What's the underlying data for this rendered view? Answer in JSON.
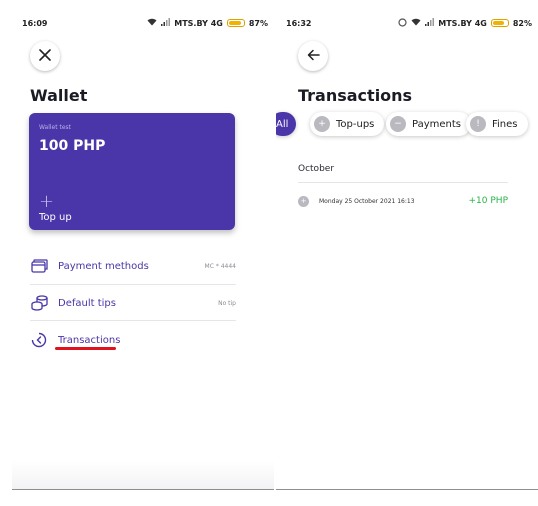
{
  "colors": {
    "primary": "#4a36a9",
    "underline": "#e0121e",
    "positive": "#28b34a"
  },
  "left": {
    "status": {
      "time": "16:09",
      "carrier": "MTS.BY 4G",
      "battery": "87%",
      "battery_level": 0.87
    },
    "close_icon": "close-icon",
    "title": "Wallet",
    "card": {
      "subtitle": "Wallet test",
      "amount": "100 PHP",
      "plus": "+",
      "topup": "Top up"
    },
    "menu": [
      {
        "label": "Payment methods",
        "value": "MC * 4444",
        "icon": "card-icon"
      },
      {
        "label": "Default tips",
        "value": "No tip",
        "icon": "coins-icon"
      },
      {
        "label": "Transactions",
        "value": "",
        "icon": "history-icon"
      }
    ]
  },
  "right": {
    "status": {
      "time": "16:32",
      "carrier": "MTS.BY 4G",
      "battery": "82%",
      "battery_level": 0.82
    },
    "back_icon": "arrow-left-icon",
    "title": "Transactions",
    "filters": [
      {
        "label": "All",
        "active": true
      },
      {
        "label": "Top-ups",
        "active": false
      },
      {
        "label": "Payments",
        "active": false
      },
      {
        "label": "Fines",
        "active": false
      }
    ],
    "month": "October",
    "transactions": [
      {
        "date": "Monday 25 October 2021 16:13",
        "amount": "+10 PHP"
      }
    ]
  }
}
